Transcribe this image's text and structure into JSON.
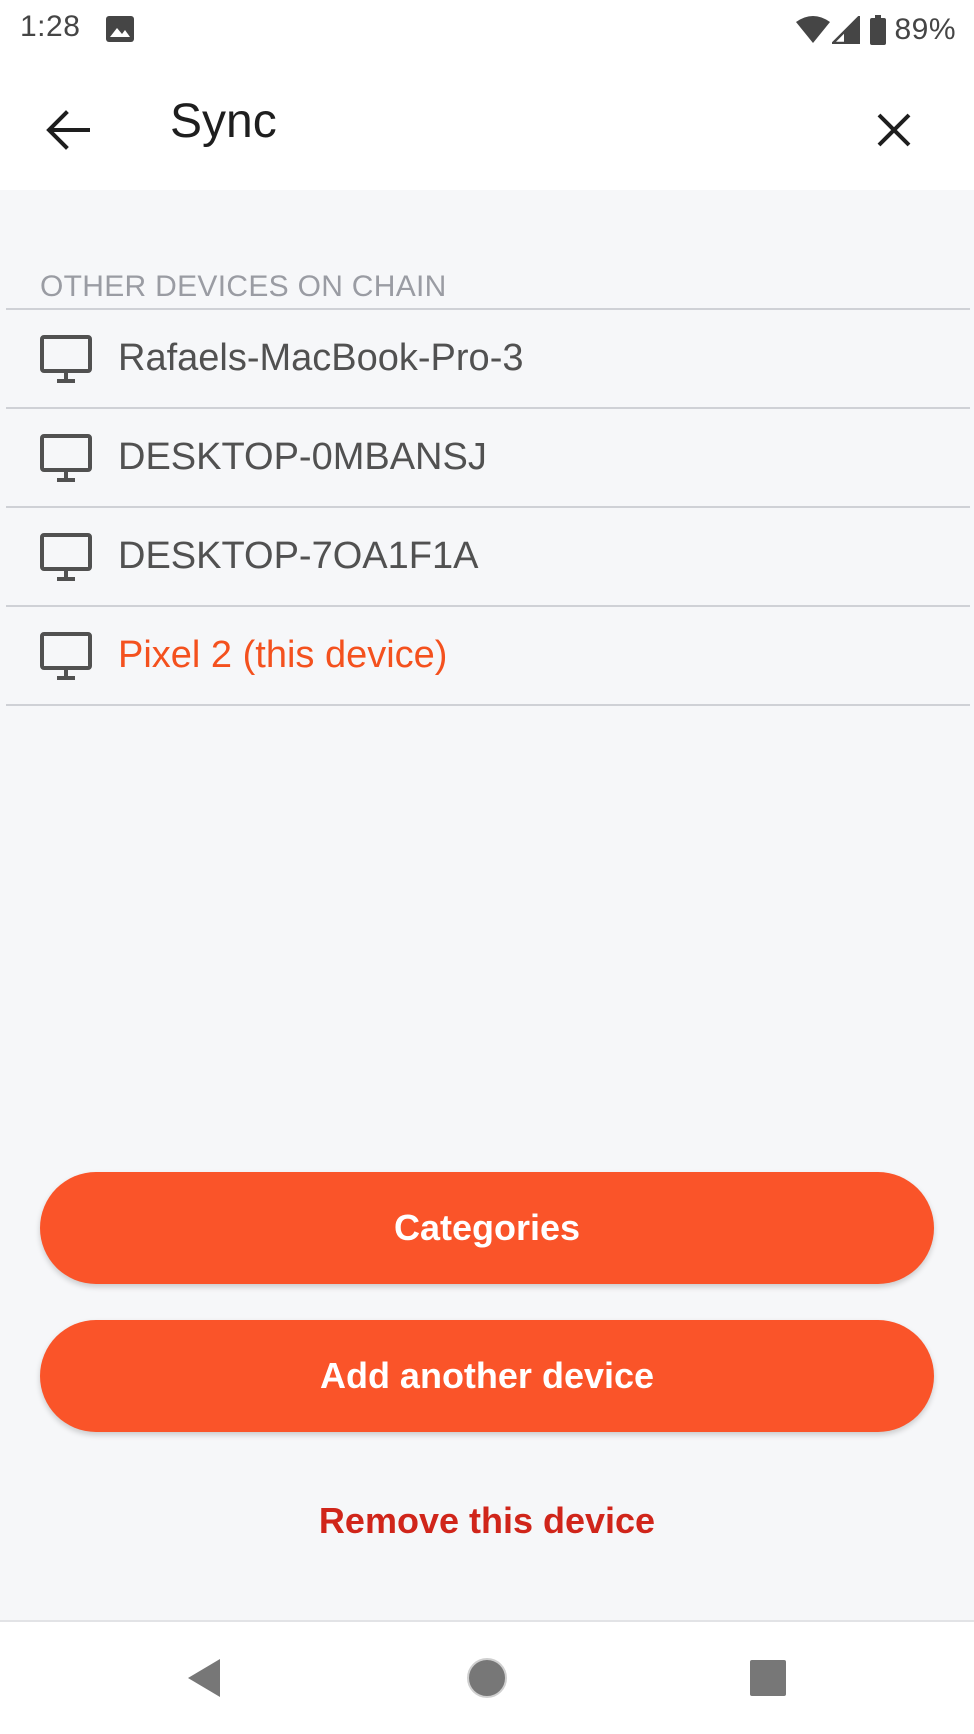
{
  "status_bar": {
    "time": "1:28",
    "battery": "89%",
    "icons": [
      "image-icon",
      "wifi-icon",
      "signal-icon",
      "battery-icon"
    ]
  },
  "app_bar": {
    "title": "Sync",
    "back_icon": "arrow-back-icon",
    "close_icon": "close-icon"
  },
  "devices": {
    "header": "OTHER DEVICES ON CHAIN",
    "items": [
      {
        "name": "Rafaels-MacBook-Pro-3",
        "icon": "desktop-icon"
      },
      {
        "name": "DESKTOP-0MBANSJ",
        "icon": "desktop-icon"
      },
      {
        "name": "DESKTOP-7OA1F1A",
        "icon": "desktop-icon"
      },
      {
        "name": "Pixel 2 (this device)",
        "icon": "desktop-icon",
        "current": true
      }
    ]
  },
  "actions": {
    "categories_label": "Categories",
    "add_device_label": "Add another device",
    "remove_label": "Remove this device"
  },
  "nav_bar": {
    "icons": [
      "nav-back-icon",
      "nav-home-icon",
      "nav-recents-icon"
    ]
  },
  "colors": {
    "accent": "#fa5429",
    "current_device": "#f4511e",
    "destructive": "#d0251a",
    "background": "#f6f7f9"
  }
}
